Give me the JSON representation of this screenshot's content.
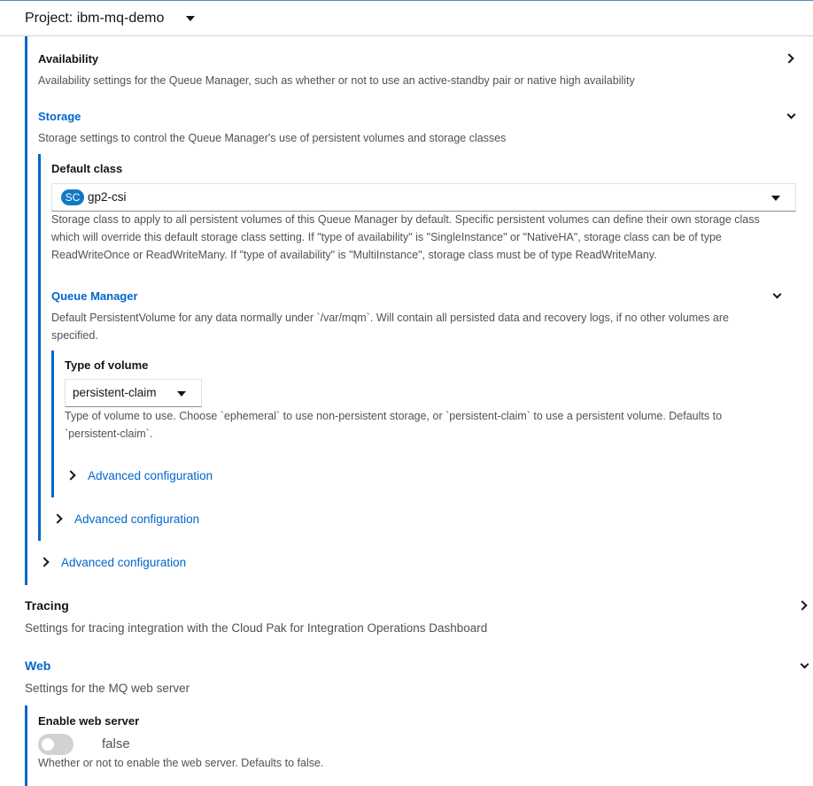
{
  "project": {
    "label": "Project: ibm-mq-demo"
  },
  "availability": {
    "title": "Availability",
    "description": "Availability settings for the Queue Manager, such as whether or not to use an active-standby pair or native high availability"
  },
  "storage": {
    "title": "Storage",
    "description": "Storage settings to control the Queue Manager's use of persistent volumes and storage classes",
    "default_class": {
      "label": "Default class",
      "badge": "SC",
      "value": "gp2-csi",
      "help_lines": [
        "Storage class to apply to all persistent volumes of this Queue Manager by default. Specific persistent volumes can define their own storage class",
        "which will override this default storage class setting. If \"type of availability\" is \"SingleInstance\" or \"NativeHA\", storage class can be of type",
        "ReadWriteOnce or ReadWriteMany. If \"type of availability\" is \"MultiInstance\", storage class must be of type ReadWriteMany."
      ]
    },
    "queue_manager": {
      "title": "Queue Manager",
      "description_lines": [
        "Default PersistentVolume for any data normally under `/var/mqm`. Will contain all persisted data and recovery logs, if no other volumes are",
        "specified."
      ],
      "type_of_volume": {
        "label": "Type of volume",
        "value": "persistent-claim",
        "help_lines": [
          "Type of volume to use. Choose `ephemeral` to use non-persistent storage, or `persistent-claim` to use a persistent volume. Defaults to",
          "`persistent-claim`."
        ]
      },
      "advanced_inner": "Advanced configuration"
    },
    "advanced_middle": "Advanced configuration",
    "advanced_outer": "Advanced configuration"
  },
  "tracing": {
    "title": "Tracing",
    "description": "Settings for tracing integration with the Cloud Pak for Integration Operations Dashboard"
  },
  "web": {
    "title": "Web",
    "description": "Settings for the MQ web server",
    "enable": {
      "label": "Enable web server",
      "value": "false",
      "help": "Whether or not to enable the web server. Defaults to false."
    }
  }
}
